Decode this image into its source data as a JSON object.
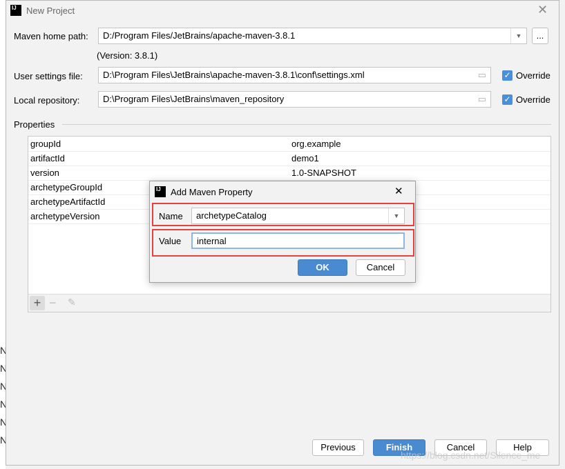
{
  "window": {
    "title": "New Project"
  },
  "maven": {
    "home_label": "Maven home path:",
    "home_value": "D:/Program Files/JetBrains/apache-maven-3.8.1",
    "browse_label": "...",
    "version": "(Version: 3.8.1)",
    "settings_label": "User settings file:",
    "settings_value": "D:\\Program Files\\JetBrains\\apache-maven-3.8.1\\conf\\settings.xml",
    "repo_label": "Local repository:",
    "repo_value": "D:\\Program Files\\JetBrains\\maven_repository",
    "override_label": "Override"
  },
  "properties": {
    "title": "Properties",
    "rows": [
      {
        "key": "groupId",
        "value": "org.example"
      },
      {
        "key": "artifactId",
        "value": "demo1"
      },
      {
        "key": "version",
        "value": "1.0-SNAPSHOT"
      },
      {
        "key": "archetypeGroupId",
        "value": ""
      },
      {
        "key": "archetypeArtifactId",
        "value": ""
      },
      {
        "key": "archetypeVersion",
        "value": ""
      }
    ]
  },
  "dialog": {
    "title": "Add Maven Property",
    "name_label": "Name",
    "name_value": "archetypeCatalog",
    "value_label": "Value",
    "value_value": "internal",
    "ok": "OK",
    "cancel": "Cancel"
  },
  "footer": {
    "previous": "Previous",
    "finish": "Finish",
    "cancel": "Cancel",
    "help": "Help"
  },
  "background_chars": [
    "N",
    "N",
    "N",
    "N",
    "N",
    "N"
  ],
  "watermark": "https://blog.csdn.net/Silence_me",
  "colors": {
    "accent": "#4a8ad0",
    "highlight": "#e8403c"
  }
}
